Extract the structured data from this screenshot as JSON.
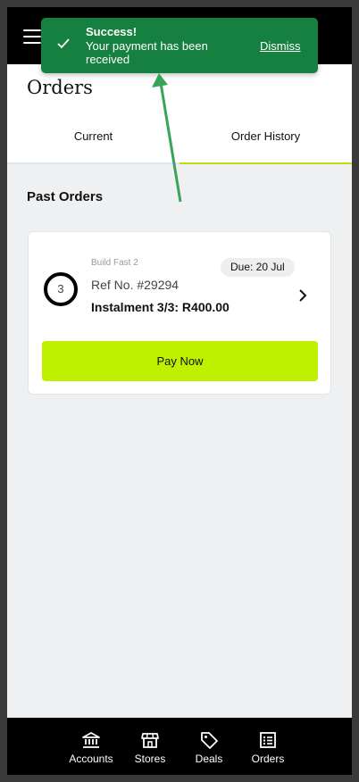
{
  "page": {
    "title": "Orders"
  },
  "tabs": [
    {
      "label": "Current",
      "active": false
    },
    {
      "label": "Order History",
      "active": true
    }
  ],
  "section": {
    "title": "Past Orders"
  },
  "order": {
    "instalment_number": "3",
    "store": "Build Fast 2",
    "due": "Due: 20 Jul",
    "ref": "Ref No. #29294",
    "instalment": "Instalment 3/3: R400.00",
    "pay_label": "Pay Now"
  },
  "toast": {
    "title": "Success!",
    "message": "Your payment has been received",
    "dismiss": "Dismiss"
  },
  "bottom_nav": [
    {
      "label": "Accounts",
      "icon": "bank-icon"
    },
    {
      "label": "Stores",
      "icon": "store-icon"
    },
    {
      "label": "Deals",
      "icon": "tag-icon"
    },
    {
      "label": "Orders",
      "icon": "list-icon"
    }
  ],
  "colors": {
    "accent_lime": "#bef000",
    "toast_green": "#168040",
    "annotation_arrow": "#3aa35a"
  }
}
